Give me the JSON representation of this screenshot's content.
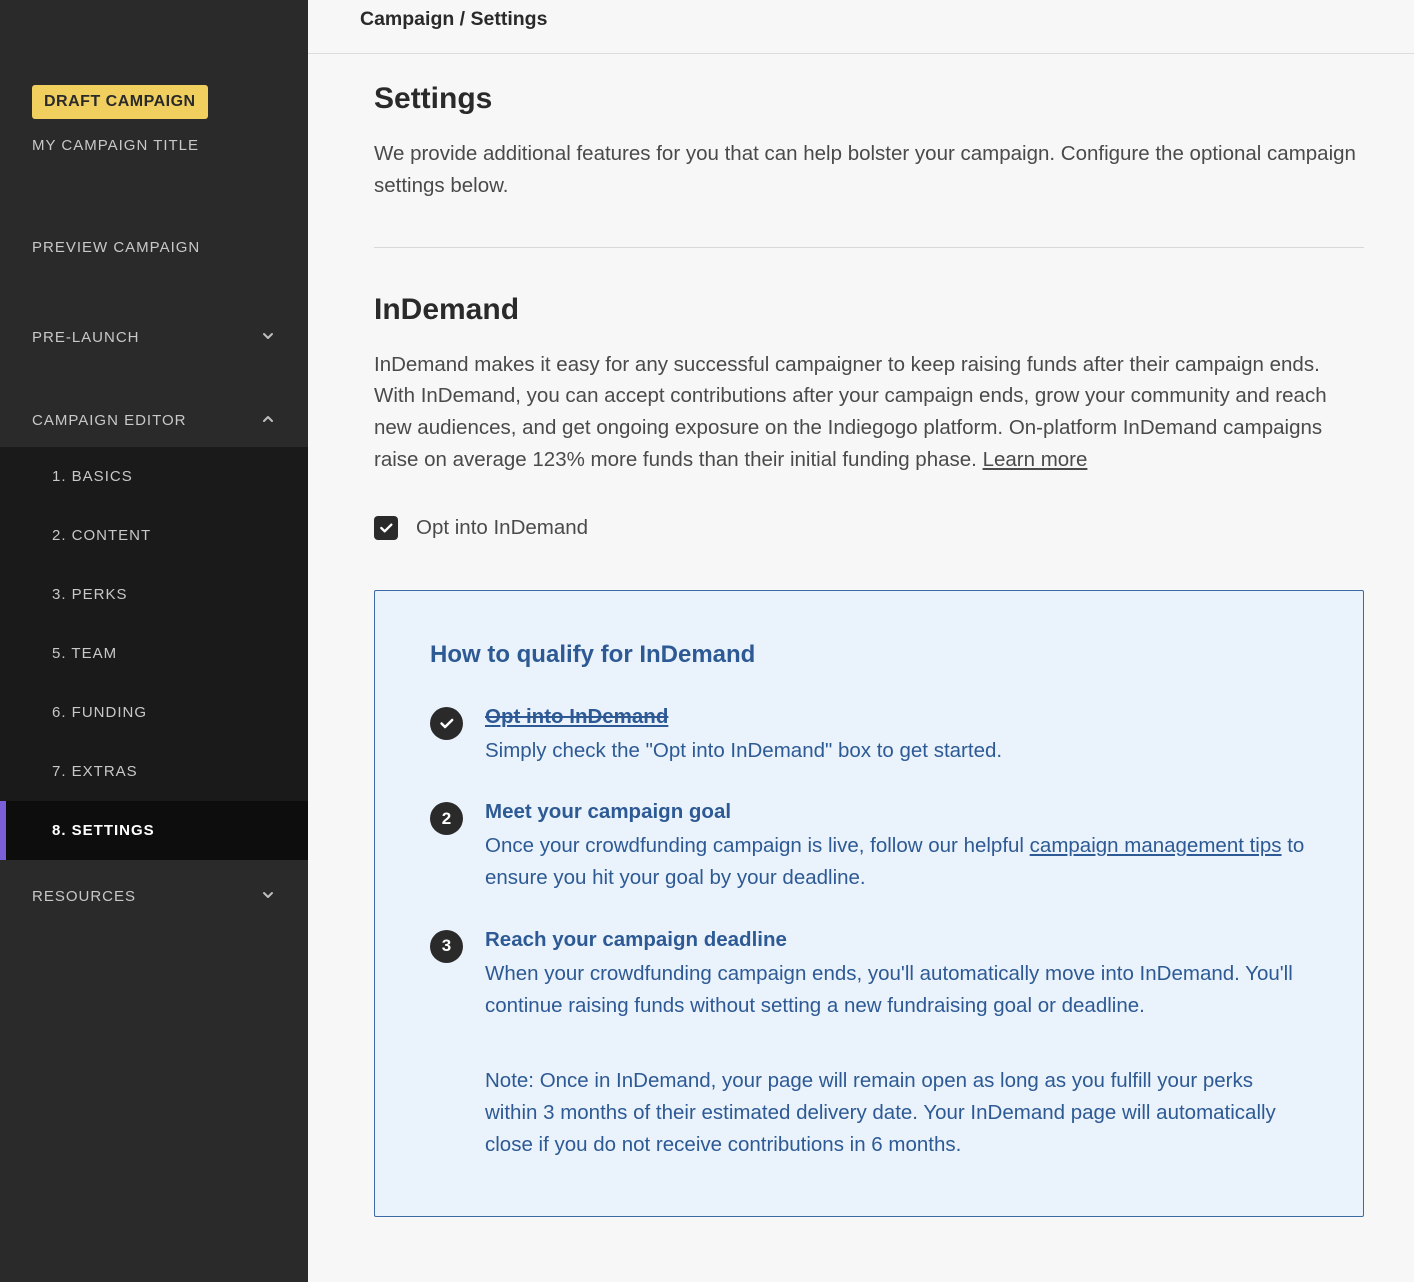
{
  "sidebar": {
    "badge": "DRAFT CAMPAIGN",
    "campaign_title": "MY CAMPAIGN TITLE",
    "preview_label": "PREVIEW CAMPAIGN",
    "sections": {
      "pre_launch": {
        "label": "PRE-LAUNCH",
        "expanded": false
      },
      "campaign_editor": {
        "label": "CAMPAIGN EDITOR",
        "expanded": true,
        "items": [
          {
            "label": "1. BASICS"
          },
          {
            "label": "2. CONTENT"
          },
          {
            "label": "3. PERKS"
          },
          {
            "label": "5. TEAM"
          },
          {
            "label": "6. FUNDING"
          },
          {
            "label": "7. EXTRAS"
          },
          {
            "label": "8. SETTINGS",
            "active": true
          }
        ]
      },
      "resources": {
        "label": "RESOURCES",
        "expanded": false
      }
    }
  },
  "breadcrumb": "Campaign / Settings",
  "settings": {
    "title": "Settings",
    "intro": "We provide additional features for you that can help bolster your campaign. Configure the optional campaign settings below."
  },
  "indemand": {
    "title": "InDemand",
    "desc": "InDemand makes it easy for any successful campaigner to keep raising funds after their campaign ends. With InDemand, you can accept contributions after your campaign ends, grow your community and reach new audiences, and get ongoing exposure on the Indiegogo platform. On-platform InDemand campaigns raise on average 123% more funds than their initial funding phase. ",
    "learn_more": "Learn more",
    "checkbox_label": "Opt into InDemand",
    "checked": true,
    "info": {
      "title": "How to qualify for InDemand",
      "steps": [
        {
          "completed": true,
          "title": "Opt into InDemand",
          "desc": "Simply check the \"Opt into InDemand\" box to get started."
        },
        {
          "num": "2",
          "title": "Meet your campaign goal",
          "desc_pre": "Once your crowdfunding campaign is live, follow our helpful ",
          "link": "campaign management tips",
          "desc_post": " to ensure you hit your goal by your deadline."
        },
        {
          "num": "3",
          "title": "Reach your campaign deadline",
          "desc": "When your crowdfunding campaign ends, you'll automatically move into InDemand. You'll continue raising funds without setting a new fundraising goal or deadline.",
          "note": "Note: Once in InDemand, your page will remain open as long as you fulfill your perks within 3 months of their estimated delivery date. Your InDemand page will automatically close if you do not receive contributions in 6 months."
        }
      ]
    }
  }
}
